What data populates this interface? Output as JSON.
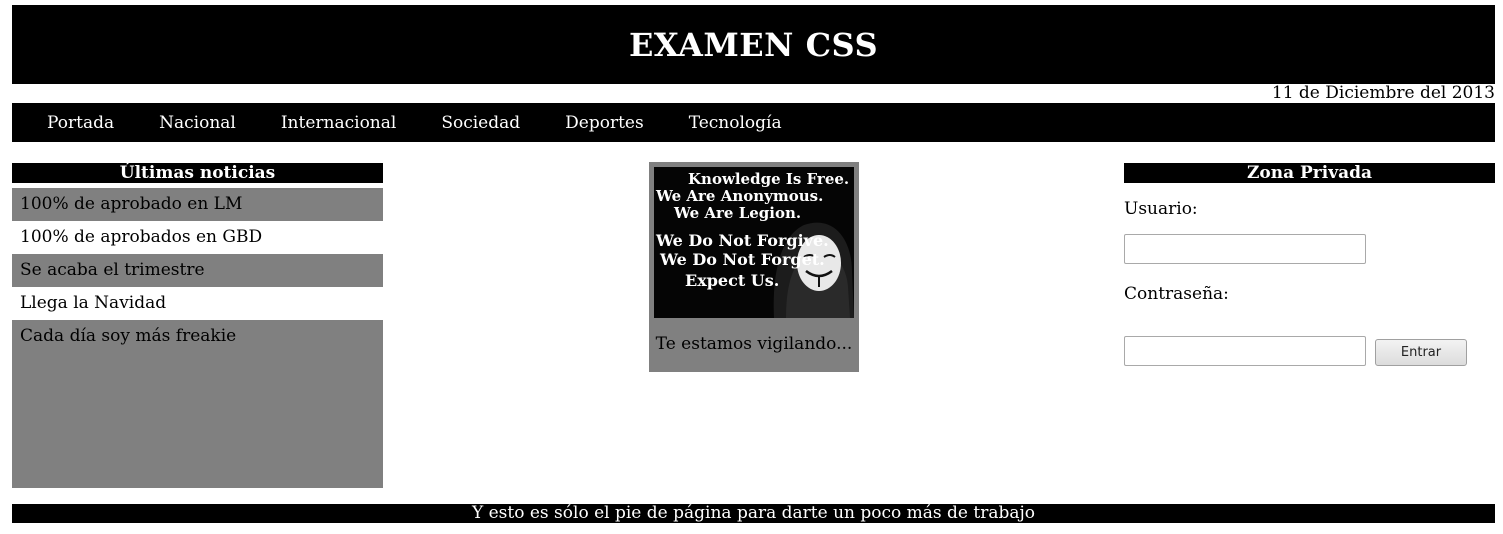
{
  "header": {
    "title": "EXAMEN CSS"
  },
  "date": "11 de Diciembre del 2013",
  "nav": {
    "items": [
      "Portada",
      "Nacional",
      "Internacional",
      "Sociedad",
      "Deportes",
      "Tecnología"
    ]
  },
  "news": {
    "title": "Últimas noticias",
    "items": [
      "100% de aprobado en LM",
      "100% de aprobados en GBD",
      "Se acaba el trimestre",
      "Llega la Navidad",
      "Cada día soy más freakie"
    ]
  },
  "center": {
    "poster_lines": [
      "Knowledge Is Free.",
      "We Are Anonymous.",
      "We Are Legion.",
      "We Do Not Forgive.",
      "We Do Not Forget.",
      "Expect Us."
    ],
    "caption": "Te estamos vigilando..."
  },
  "private": {
    "title": "Zona Privada",
    "user_label": "Usuario:",
    "password_label": "Contraseña:",
    "user_value": "",
    "password_value": "",
    "submit_label": "Entrar"
  },
  "footer": {
    "text": "Y esto es sólo el pie de página para darte un poco más de trabajo"
  },
  "colors": {
    "bar": "#000000",
    "gray_panel": "#808080",
    "background": "#ffffff"
  }
}
